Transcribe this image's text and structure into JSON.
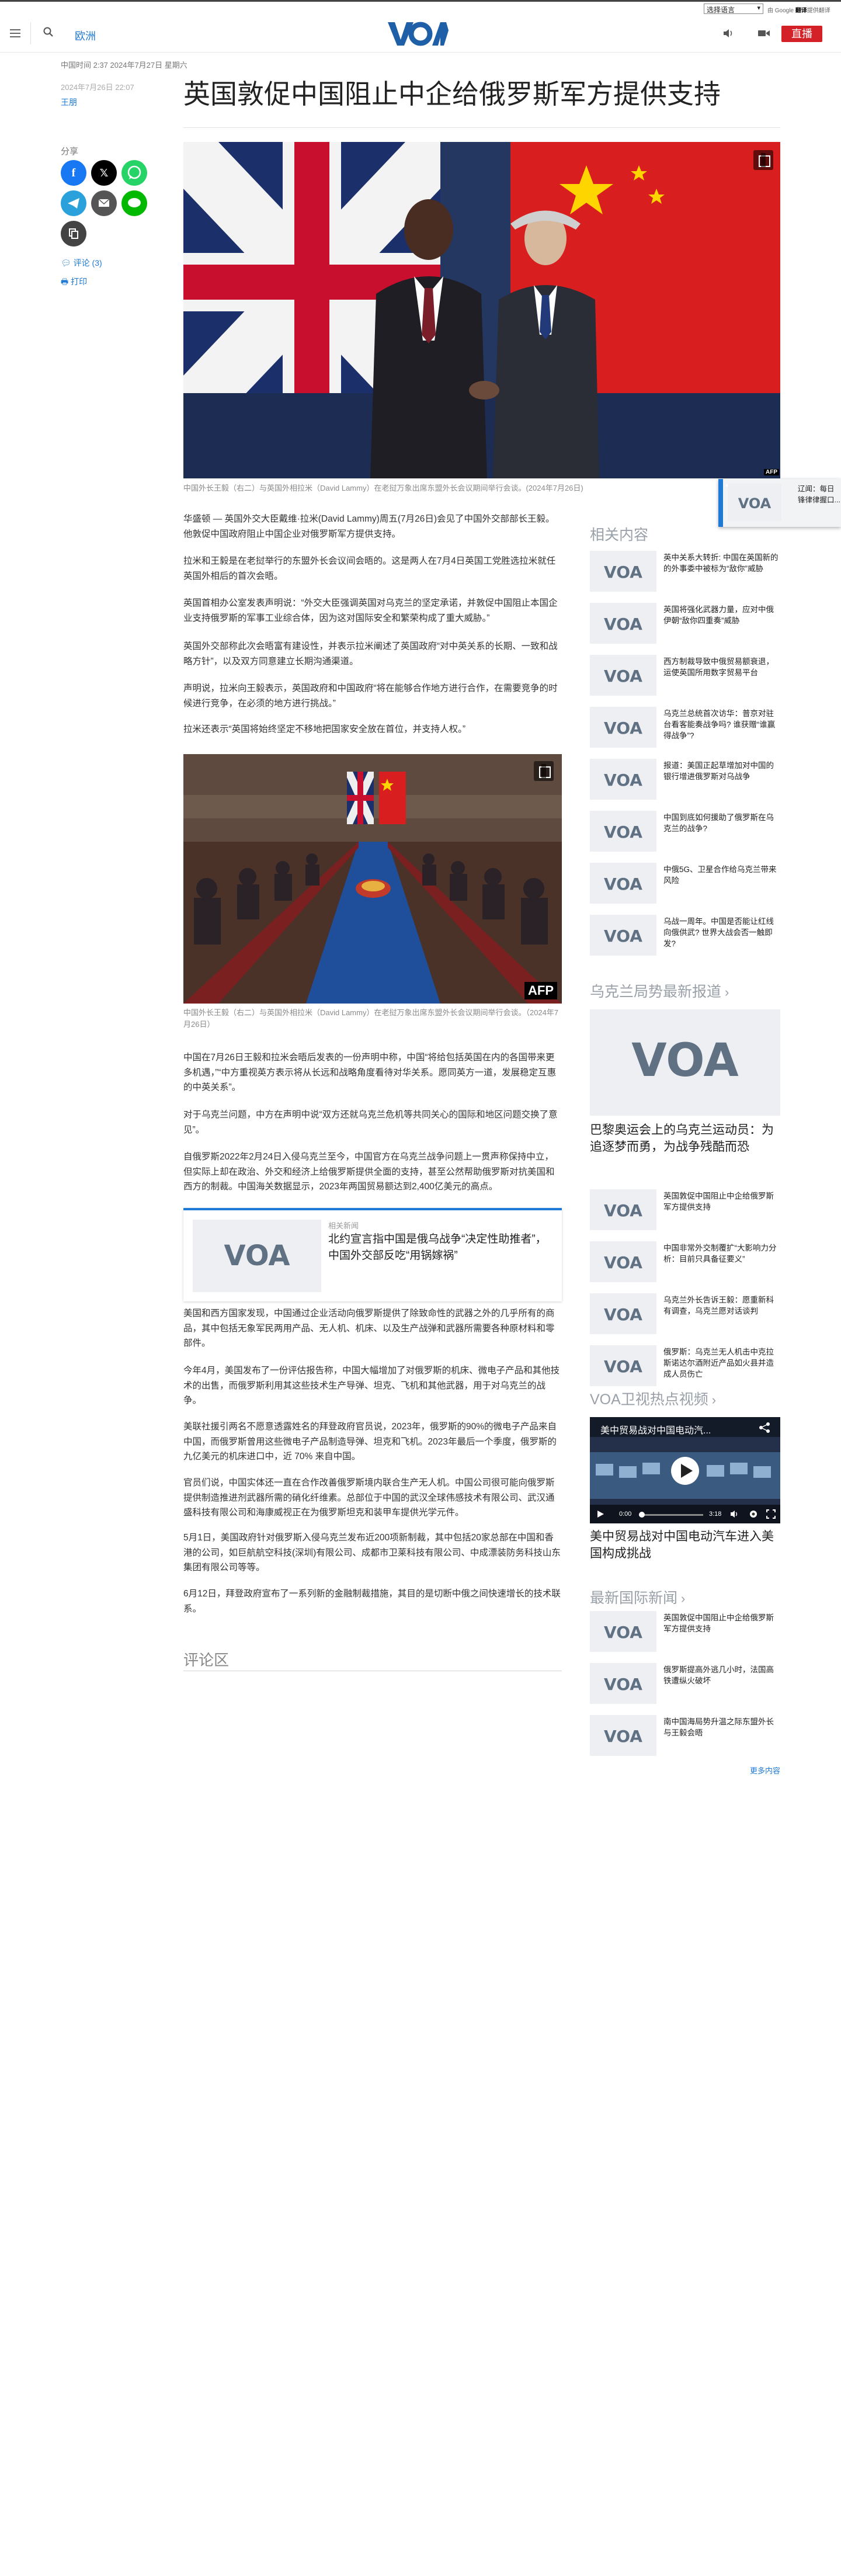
{
  "topbar": {
    "language_select": "选择语言",
    "translate_prefix": "由 Google",
    "translate_brand": "翻译",
    "translate_suffix": "提供翻译"
  },
  "header": {
    "section_link": "欧洲",
    "logo_text": "VOA",
    "live_label": "直播"
  },
  "article": {
    "timestamp": "中国时间 2:37 2024年7月27日 星期六",
    "publish_date": "2024年7月26日 22:07",
    "author": "王朋",
    "title": "英国敦促中国阻止中企给俄罗斯军方提供支持",
    "hero_caption": "中国外长王毅（右二）与英国外相拉米（David Lammy）在老挝万象出席东盟外长会议期间举行会谈。(2024年7月26日)",
    "image2_caption": "中国外长王毅（右二）与英国外相拉米（David Lammy）在老挝万象出席东盟外长会议期间举行会谈。（2024年7月26日）",
    "paragraphs": [
      "华盛顿 — 英国外交大臣戴维·拉米(David Lammy)周五(7月26日)会见了中国外交部部长王毅。他敦促中国政府阻止中国企业对俄罗斯军方提供支持。",
      "拉米和王毅是在老挝举行的东盟外长会议间会晤的。这是两人在7月4日英国工党胜选拉米就任英国外相后的首次会晤。",
      "英国首相办公室发表声明说：“外交大臣强调英国对乌克兰的坚定承诺，并敦促中国阻止本国企业支持俄罗斯的军事工业综合体，因为这对国际安全和繁荣构成了重大威胁。”",
      "英国外交部称此次会晤富有建设性，并表示拉米阐述了英国政府“对中英关系的长期、一致和战略方针”，以及双方同意建立长期沟通渠道。",
      "声明说，拉米向王毅表示，英国政府和中国政府“将在能够合作地方进行合作，在需要竞争的时候进行竞争，在必须的地方进行挑战。”",
      "拉米还表示“英国将始终坚定不移地把国家安全放在首位，并支持人权。”",
      "中国在7月26日王毅和拉米会晤后发表的一份声明中称，中国“将给包括英国在内的各国带来更多机遇，”“中方重视英方表示将从长远和战略角度看待对华关系。愿同英方一道，发展稳定互惠的中英关系”。",
      "对于乌克兰问题，中方在声明中说“双方还就乌克兰危机等共同关心的国际和地区问题交换了意见”。",
      "自俄罗斯2022年2月24日入侵乌克兰至今，中国官方在乌克兰战争问题上一贯声称保持中立，但实际上却在政治、外交和经济上给俄罗斯提供全面的支持，甚至公然帮助俄罗斯对抗美国和西方的制裁。中国海关数据显示，2023年两国贸易额达到2,400亿美元的高点。",
      "美国和西方国家发现，中国通过企业活动向俄罗斯提供了除致命性的武器之外的几乎所有的商品，其中包括无象军民两用产品、无人机、机床、以及生产战弹和武器所需要各种原材料和零部件。",
      "今年4月，美国发布了一份评估报告称，中国大幅增加了对俄罗斯的机床、微电子产品和其他技术的出售，而俄罗斯利用其这些技术生产导弹、坦克、飞机和其他武器，用于对乌克兰的战争。",
      "美联社援引两名不愿意透露姓名的拜登政府官员说，2023年，俄罗斯的90%的微电子产品来自中国，而俄罗斯曾用这些微电子产品制造导弹、坦克和飞机。2023年最后一个季度，俄罗斯的九亿美元的机床进口中，近 70% 来自中国。",
      "官员们说，中国实体还一直在合作改善俄罗斯境内联合生产无人机。中国公司很可能向俄罗斯提供制造推进剂武器所需的硝化纤维素。总部位于中国的武汉全球伟感技术有限公司、武汉通盛科技有限公司和海康威视正在为俄罗斯坦克和装甲车提供光学元件。",
      "5月1日，美国政府针对俄罗斯入侵乌克兰发布近200项新制裁，其中包括20家总部在中国和香港的公司，如巨航航空科技(深圳)有限公司、成都市卫莱科技有限公司、中成漂装防务科技山东集团有限公司等等。",
      "6月12日，拜登政府宣布了一系列新的金融制裁措施，其目的是切断中俄之间快速增长的技术联系。"
    ],
    "share_label": "分享",
    "comments_link": "评论 (3)",
    "print_link": "打印",
    "related_box": {
      "label": "相关新闻",
      "title": "北约宣言指中国是俄乌战争“决定性助推者”，中国外交部反吃“用锅嫁祸”"
    },
    "comments_section": "评论区"
  },
  "sidebar": {
    "related_header": "相关内容",
    "related_items": [
      "英中关系大转折: 中国在英国新的的外事委中被标为“敌你”威胁",
      "英国将强化武器力量，应对中俄伊朝“敌你四重奏”威胁",
      "西方制裁导致中俄贸易额衰退，运使英国所用数字贸易平台",
      "乌克兰总统首次访华：普京对驻台看客能奏战争吗? 谁获赠“谁赢得战争”?",
      "报道：美国正起草增加对中国的银行增进俄罗斯对乌战争",
      "中国到底如何援助了俄罗斯在乌克兰的战争?",
      "中俄5G、卫星合作给乌克兰带来风险",
      "乌战一周年。中国是否能让红线向俄供武? 世界大战会否一触即发?"
    ],
    "ukraine_header": "乌克兰局势最新报道",
    "ukraine_big_caption": "巴黎奥运会上的乌克兰运动员：为追逐梦而勇，为战争残酷而恐",
    "ukraine_items": [
      "英国敦促中国阻止中企给俄罗斯军方提供支持",
      "中国非常外交制覆扩“大影响力分析：目前只具备征要义”",
      "乌克兰外长告诉王毅：愿重新科有调查，乌克兰愿对话谈判",
      "俄罗斯：乌克兰无人机击中克拉斯诺达尔酒附近产品如火县并造成人员伤亡"
    ],
    "video_header": "VOA卫视热点视频",
    "video_overlay_title": "美中贸易战对中国电动汽...",
    "video_time": "0:00",
    "video_duration": "3:18",
    "video_caption": "美中贸易战对中国电动汽车进入美国构成挑战",
    "intl_header": "最新国际新闻",
    "intl_items": [
      "英国敦促中国阻止中企给俄罗斯军方提供支持",
      "俄罗斯提高外逃几小时，法国高铁遭纵火破坏",
      "南中国海局势升温之际东盟外长与王毅会晤"
    ],
    "more_link": "更多内容"
  },
  "popup": {
    "text": "辽闻：每日锋律律握口..."
  }
}
